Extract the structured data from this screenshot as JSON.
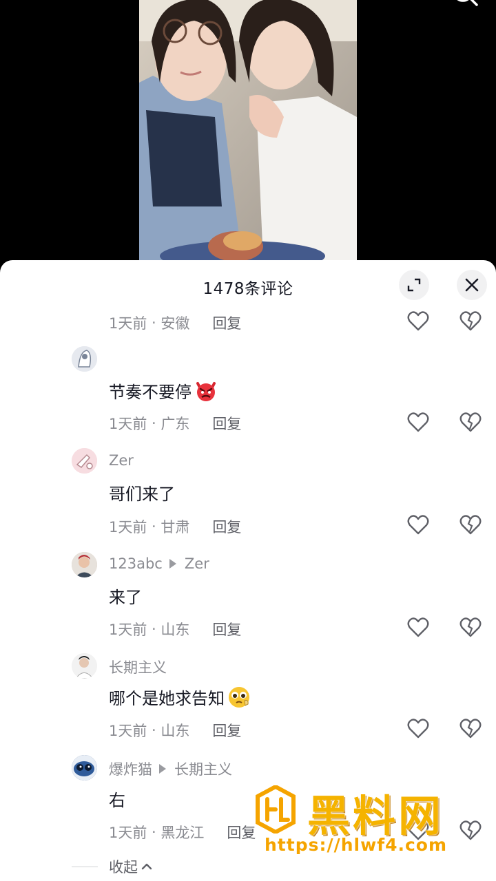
{
  "header": {
    "comment_count_title": "1478条评论",
    "expand_icon": "expand-icon",
    "close_icon": "close-icon"
  },
  "comments": [
    {
      "username": "",
      "reply_to": "",
      "content": "",
      "time": "1天前",
      "location": "安徽",
      "reply_label": "回复"
    },
    {
      "username": "",
      "reply_to": "",
      "content": "节奏不要停",
      "emoji": "angry-devil-emoji",
      "time": "1天前",
      "location": "广东",
      "reply_label": "回复"
    },
    {
      "username": "Zer",
      "reply_to": "",
      "content": "哥们来了",
      "time": "1天前",
      "location": "甘肃",
      "reply_label": "回复"
    },
    {
      "username": "123abc",
      "reply_to": "Zer",
      "content": "来了",
      "time": "1天前",
      "location": "山东",
      "reply_label": "回复"
    },
    {
      "username": "长期主义",
      "reply_to": "",
      "content": "哪个是她求告知",
      "emoji": "pleading-face-emoji",
      "time": "1天前",
      "location": "山东",
      "reply_label": "回复"
    },
    {
      "username": "爆炸猫",
      "reply_to": "长期主义",
      "content": "右",
      "time": "1天前",
      "location": "黑龙江",
      "reply_label": "回复"
    }
  ],
  "collapse_label": "收起",
  "watermark": {
    "brand": "黑料网",
    "url": "https://hlwf4.com"
  },
  "colors": {
    "accent_watermark": "#f5b300",
    "text_primary": "#161823",
    "text_secondary": "#8a8b91"
  }
}
